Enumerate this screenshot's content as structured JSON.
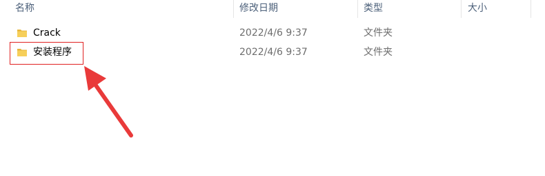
{
  "columns": {
    "name": "名称",
    "date_modified": "修改日期",
    "type": "类型",
    "size": "大小"
  },
  "files": [
    {
      "name": "Crack",
      "date_modified": "2022/4/6 9:37",
      "type": "文件夹",
      "size": "",
      "icon": "folder-icon"
    },
    {
      "name": "安装程序",
      "date_modified": "2022/4/6 9:37",
      "type": "文件夹",
      "size": "",
      "icon": "folder-icon"
    }
  ],
  "annotation": {
    "highlight_color": "#e02020",
    "target": "安装程序"
  },
  "colors": {
    "header_text": "#4c607a",
    "folder_yellow": "#f2c94c",
    "annotation_red": "#e93a3a"
  }
}
